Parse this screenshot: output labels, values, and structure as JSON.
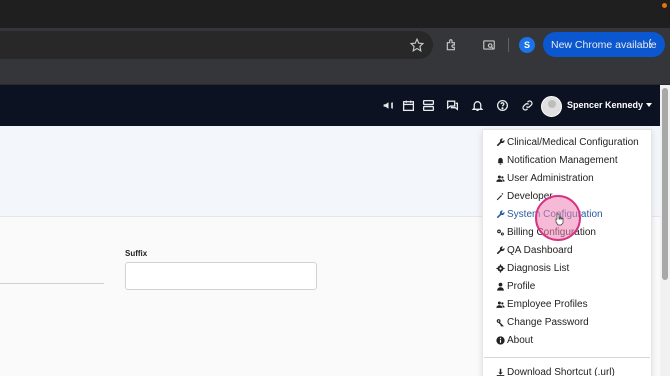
{
  "browser": {
    "update_button_label": "New Chrome available",
    "profile_initial": "S",
    "toolbar_icons": [
      "star-icon",
      "extensions-icon",
      "tab-search-icon"
    ]
  },
  "app": {
    "nav_icons": [
      "megaphone-icon",
      "calendar-icon",
      "layers-icon",
      "chat-icon",
      "bell-icon",
      "help-icon",
      "link-icon"
    ],
    "user_name": "Spencer Kennedy"
  },
  "form": {
    "suffix_label": "Suffix",
    "suffix_value": ""
  },
  "menu": {
    "items": [
      {
        "label": "Clinical/Medical Configuration",
        "icon": "wrench-icon"
      },
      {
        "label": "Notification Management",
        "icon": "bell-icon"
      },
      {
        "label": "User Administration",
        "icon": "users-icon"
      },
      {
        "label": "Developer",
        "icon": "magic-wand-icon"
      },
      {
        "label": "System Configuration",
        "icon": "wrench-icon",
        "active": true
      },
      {
        "label": "Billing Configuration",
        "icon": "cogs-icon"
      },
      {
        "label": "QA Dashboard",
        "icon": "wrench-icon"
      },
      {
        "label": "Diagnosis List",
        "icon": "gear-icon"
      },
      {
        "label": "Profile",
        "icon": "user-icon"
      },
      {
        "label": "Employee Profiles",
        "icon": "users-icon"
      },
      {
        "label": "Change Password",
        "icon": "key-icon"
      },
      {
        "label": "About",
        "icon": "info-icon"
      },
      {
        "label": "Download Shortcut (.url)",
        "icon": "download-icon"
      }
    ]
  },
  "colors": {
    "nav_bg": "#0c1222",
    "active_item": "#2a5aa0",
    "update_button": "#0b57d0",
    "click_ring": "#d63384"
  }
}
